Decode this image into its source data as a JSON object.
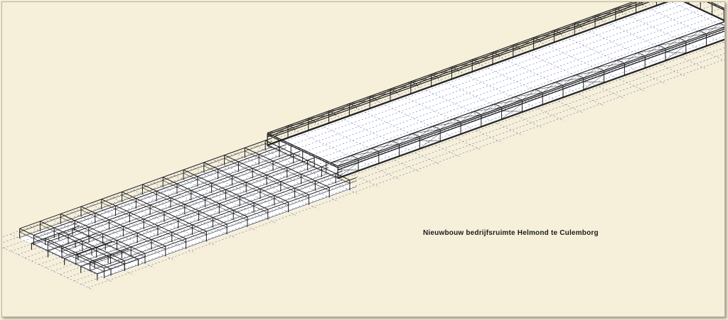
{
  "drawing": {
    "caption": "Nieuwbouw bedrijfsruimte Helmond te Culemborg"
  },
  "colors": {
    "background": "#f6efd9",
    "structure": "#1d1d1d",
    "grid": "#3e4fa8",
    "floor": "#ffffff"
  }
}
